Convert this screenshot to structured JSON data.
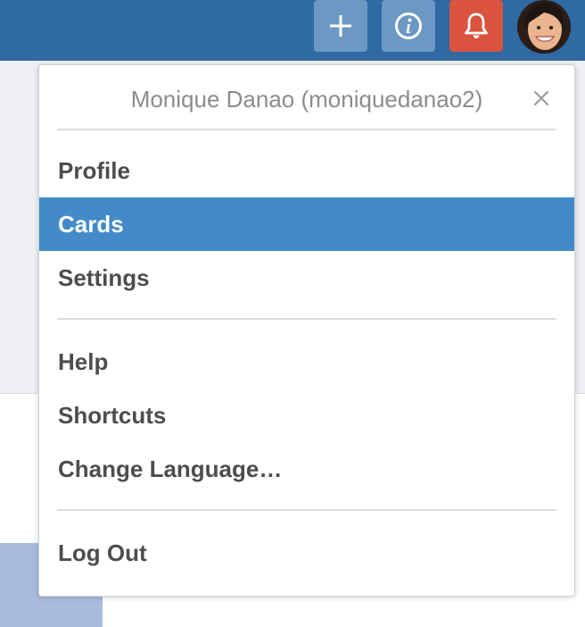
{
  "header": {
    "add_icon": "plus-icon",
    "info_icon": "info-icon",
    "notifications_icon": "bell-icon",
    "avatar_icon": "user-avatar",
    "colors": {
      "bar": "#2f6aa3",
      "button": "#6c99c3",
      "notification_button": "#d9533f"
    }
  },
  "menu": {
    "title": "Monique Danao (moniquedanao2)",
    "close_icon": "close-icon",
    "items": [
      {
        "label": "Profile"
      },
      {
        "label": "Cards",
        "active": true
      },
      {
        "label": "Settings"
      },
      {
        "label": "Help"
      },
      {
        "label": "Shortcuts"
      },
      {
        "label": "Change Language…"
      },
      {
        "label": "Log Out"
      }
    ],
    "colors": {
      "active_background": "#428bc8",
      "item_text": "#4d4d4d",
      "title_text": "#8c8c8c"
    }
  }
}
